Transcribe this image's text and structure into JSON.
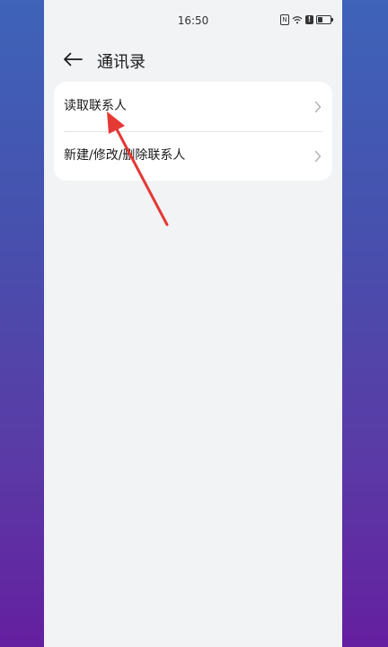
{
  "status_bar": {
    "time": "16:50",
    "icons": [
      "nfc-icon",
      "wifi-icon",
      "alert-icon",
      "battery-icon"
    ],
    "nfc_glyph": "N",
    "alert_glyph": "!",
    "battery_level": 0.4
  },
  "header": {
    "title": "通讯录",
    "back_icon": "arrow-left-icon"
  },
  "list": {
    "items": [
      {
        "label": "读取联系人",
        "icon": "chevron-right-icon"
      },
      {
        "label": "新建/修改/删除联系人",
        "icon": "chevron-right-icon"
      }
    ]
  },
  "annotation": {
    "type": "arrow",
    "color": "#E53935",
    "target": "读取联系人"
  },
  "colors": {
    "screen_bg": "#F1F3F5",
    "card_bg": "#FFFFFF",
    "text": "#1A1A1A",
    "chevron": "#B3B3B3",
    "gradient_top": "#3E63B8",
    "gradient_bottom": "#651FA0"
  }
}
